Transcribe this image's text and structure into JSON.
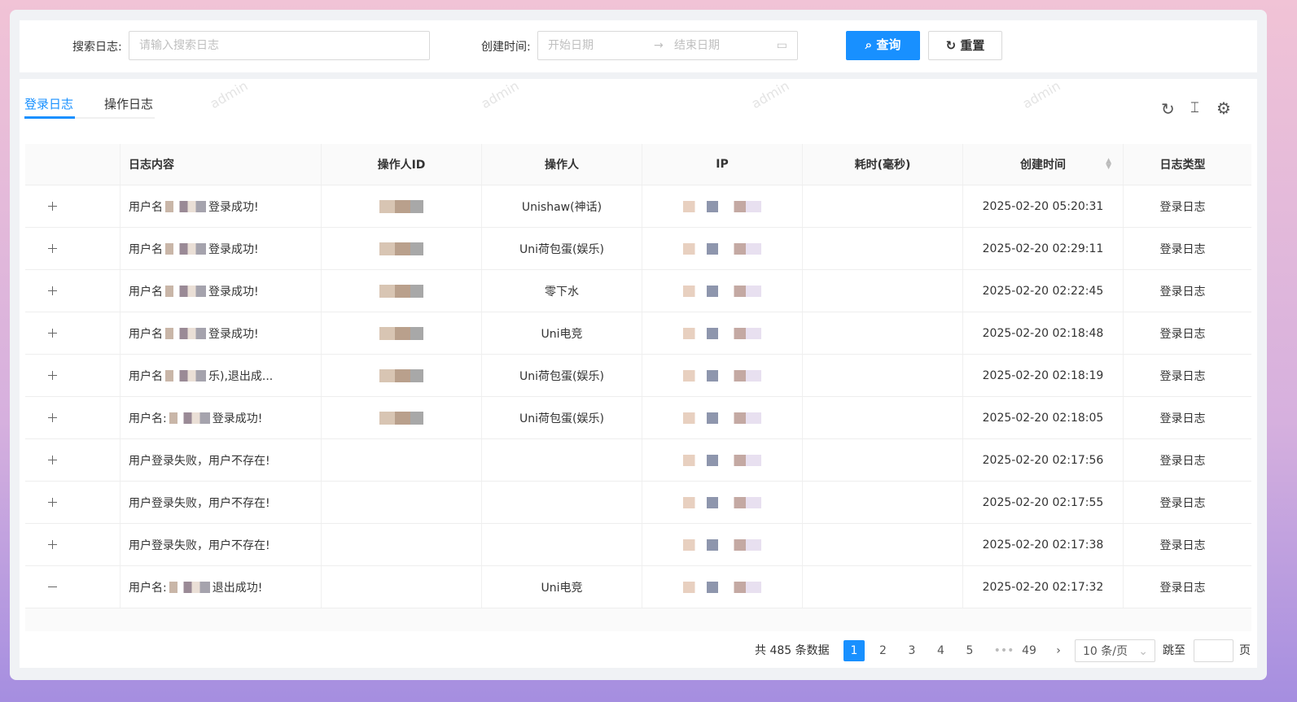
{
  "search": {
    "log_label": "搜索日志:",
    "log_placeholder": "请输入搜索日志",
    "time_label": "创建时间:",
    "start_placeholder": "开始日期",
    "end_placeholder": "结束日期",
    "query_button": "查询",
    "reset_button": "重置"
  },
  "tabs": [
    {
      "label": "登录日志",
      "active": true
    },
    {
      "label": "操作日志",
      "active": false
    }
  ],
  "watermark": "admin",
  "table": {
    "headers": [
      "",
      "日志内容",
      "操作人ID",
      "操作人",
      "IP",
      "耗时(毫秒)",
      "创建时间",
      "日志类型"
    ],
    "rows": [
      {
        "prefix": "用户名",
        "masked": true,
        "suffix": "登录成功!",
        "operator": "Unishaw(神话)",
        "time": "2025-02-20 05:20:31",
        "type": "登录日志",
        "expanded": false,
        "has_id": true
      },
      {
        "prefix": "用户名",
        "masked": true,
        "suffix": "登录成功!",
        "operator": "Uni荷包蛋(娱乐)",
        "time": "2025-02-20 02:29:11",
        "type": "登录日志",
        "expanded": false,
        "has_id": true
      },
      {
        "prefix": "用户名",
        "masked": true,
        "suffix": "登录成功!",
        "operator": "零下水",
        "time": "2025-02-20 02:22:45",
        "type": "登录日志",
        "expanded": false,
        "has_id": true
      },
      {
        "prefix": "用户名",
        "masked": true,
        "suffix": "登录成功!",
        "operator": "Uni电竞",
        "time": "2025-02-20 02:18:48",
        "type": "登录日志",
        "expanded": false,
        "has_id": true
      },
      {
        "prefix": "用户名",
        "masked": true,
        "suffix": "乐),退出成...",
        "operator": "Uni荷包蛋(娱乐)",
        "time": "2025-02-20 02:18:19",
        "type": "登录日志",
        "expanded": false,
        "has_id": true
      },
      {
        "prefix": "用户名:",
        "masked": true,
        "suffix": "登录成功!",
        "operator": "Uni荷包蛋(娱乐)",
        "time": "2025-02-20 02:18:05",
        "type": "登录日志",
        "expanded": false,
        "has_id": true
      },
      {
        "prefix": "用户登录失败，用户不存在!",
        "masked": false,
        "suffix": "",
        "operator": "",
        "time": "2025-02-20 02:17:56",
        "type": "登录日志",
        "expanded": false,
        "has_id": false
      },
      {
        "prefix": "用户登录失败，用户不存在!",
        "masked": false,
        "suffix": "",
        "operator": "",
        "time": "2025-02-20 02:17:55",
        "type": "登录日志",
        "expanded": false,
        "has_id": false
      },
      {
        "prefix": "用户登录失败，用户不存在!",
        "masked": false,
        "suffix": "",
        "operator": "",
        "time": "2025-02-20 02:17:38",
        "type": "登录日志",
        "expanded": false,
        "has_id": false
      },
      {
        "prefix": "用户名:",
        "masked": true,
        "suffix": "退出成功!",
        "operator": "Uni电竞",
        "time": "2025-02-20 02:17:32",
        "type": "登录日志",
        "expanded": true,
        "has_id": false
      }
    ]
  },
  "pagination": {
    "total": "共 485 条数据",
    "pages": [
      "1",
      "2",
      "3",
      "4",
      "5"
    ],
    "current": "1",
    "last": "49",
    "ellipsis": "•••",
    "page_size": "10 条/页",
    "jump_label": "跳至",
    "page_suffix": "页"
  }
}
